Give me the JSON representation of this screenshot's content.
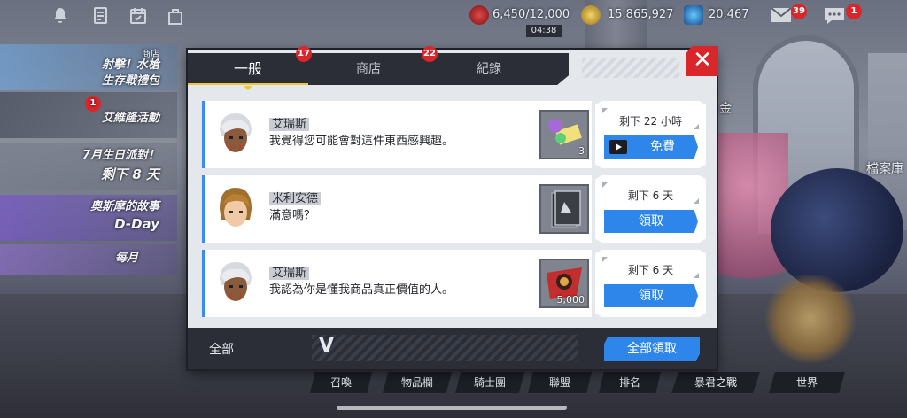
{
  "topbar": {
    "stamina": "6,450/12,000",
    "stamina_timer": "04:38",
    "gold": "15,865,927",
    "gems": "20,467",
    "mail_badge": "39",
    "chat_badge": "1"
  },
  "left_panels": [
    {
      "title": "商店",
      "line1": "射擊！水槍",
      "line2": "生存戰禮包"
    },
    {
      "title": "艾維隆活動",
      "badge": "1"
    },
    {
      "title": "7月生日派對！",
      "line2": "剩下 8 天"
    },
    {
      "title": "奧斯摩的故事",
      "line2": "D-Day"
    },
    {
      "title": "每月"
    }
  ],
  "background_labels": {
    "gold_label": "金",
    "archive_label": "檔案庫"
  },
  "bottom_menu": [
    "召喚",
    "物品欄",
    "騎士團",
    "聯盟",
    "排名",
    "暴君之戰",
    "世界"
  ],
  "modal": {
    "tabs": [
      {
        "label": "一般",
        "badge": "17"
      },
      {
        "label": "商店",
        "badge": "22"
      },
      {
        "label": "紀錄"
      }
    ],
    "close_label": "✕",
    "messages": [
      {
        "name": "艾瑞斯",
        "text": "我覺得您可能會對這件東西感興趣。",
        "item_qty": "3",
        "remaining": "剩下 22 小時",
        "button": "免費",
        "button_type": "video"
      },
      {
        "name": "米利安德",
        "text": "滿意嗎？",
        "item_qty": "",
        "remaining": "剩下 6 天",
        "button": "領取",
        "button_type": "claim"
      },
      {
        "name": "艾瑞斯",
        "text": "我認為你是懂我商品真正價值的人。",
        "item_qty": "5,000",
        "remaining": "剩下 6 天",
        "button": "領取",
        "button_type": "claim"
      }
    ],
    "footer": {
      "filter_label": "全部",
      "chevron": "V",
      "claim_all": "全部領取"
    }
  },
  "colors": {
    "accent_blue": "#2f86ea",
    "badge_red": "#d8262b",
    "tab_underline": "#e9c93a",
    "dark_panel": "#2b2e37"
  }
}
